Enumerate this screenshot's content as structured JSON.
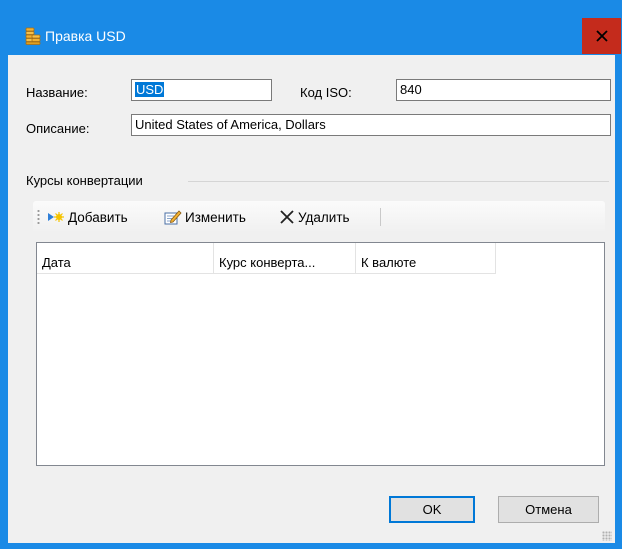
{
  "window": {
    "title": "Правка USD",
    "close_glyph": "✕",
    "icon": "coins-icon"
  },
  "form": {
    "name_label": "Название:",
    "name_value": "USD",
    "iso_label": "Код ISO:",
    "iso_value": "840",
    "description_label": "Описание:",
    "description_value": "United States of America, Dollars"
  },
  "rates": {
    "group_label": "Курсы конвертации",
    "toolbar": {
      "add_label": "Добавить",
      "edit_label": "Изменить",
      "delete_label": "Удалить"
    },
    "columns": [
      "Дата",
      "Курс конверта...",
      "К валюте"
    ],
    "rows": []
  },
  "buttons": {
    "ok_label": "OK",
    "cancel_label": "Отмена"
  },
  "colors": {
    "titlebar": "#1a8ae6",
    "close": "#c42b1c",
    "selection": "#0078d7"
  }
}
